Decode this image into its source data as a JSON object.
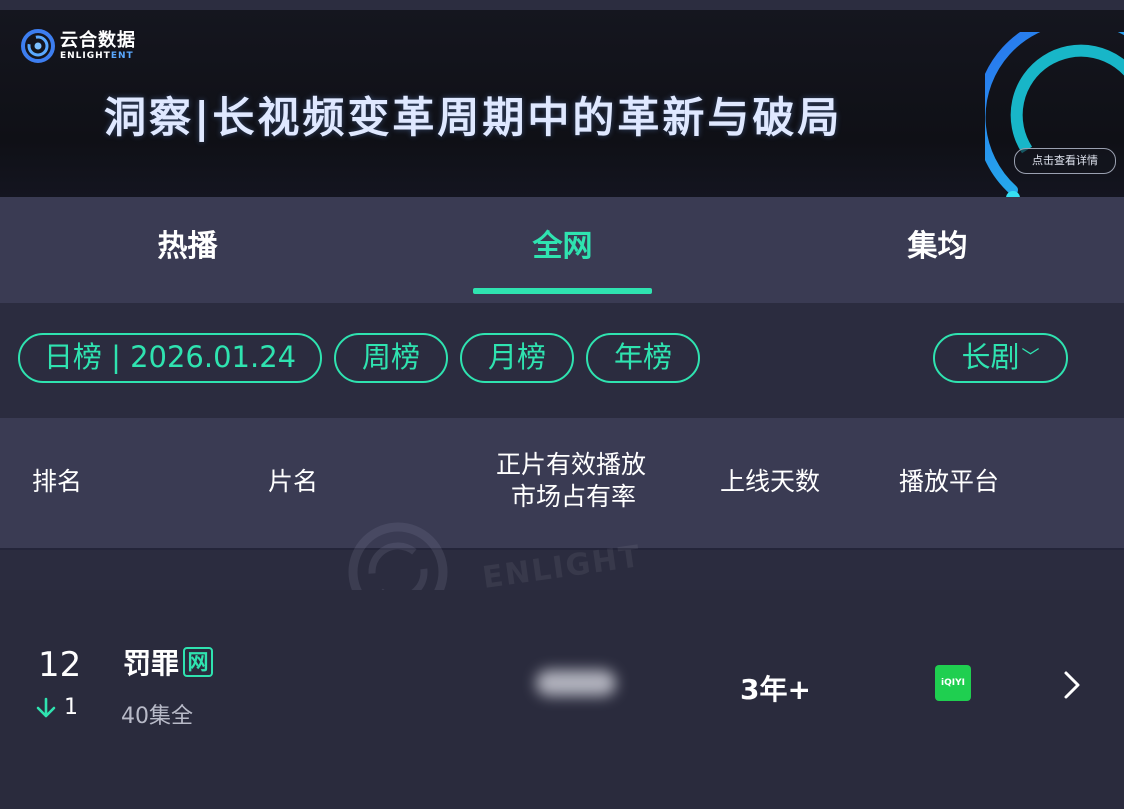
{
  "banner": {
    "logo_cn": "云合数据",
    "logo_en": "ENLIGHT",
    "logo_en_accent": "ENT",
    "title": "洞察|长视频变革周期中的革新与破局",
    "detail_button": "点击查看详情"
  },
  "tabs": [
    {
      "label": "热播",
      "active": false
    },
    {
      "label": "全网",
      "active": true
    },
    {
      "label": "集均",
      "active": false
    }
  ],
  "filters": {
    "daily": "日榜 | 2026.01.24",
    "weekly": "周榜",
    "monthly": "月榜",
    "yearly": "年榜",
    "category": "长剧"
  },
  "table": {
    "headers": {
      "rank": "排名",
      "title": "片名",
      "share_line1": "正片有效播放",
      "share_line2": "市场占有率",
      "days": "上线天数",
      "platform": "播放平台"
    },
    "rows": [
      {
        "rank": "12",
        "rank_change": "1",
        "rank_direction": "down",
        "title": "罚罪",
        "title_badge": "网",
        "episodes": "40集全",
        "days_online": "3年+",
        "platform": "iQIYI"
      }
    ]
  },
  "colors": {
    "accent": "#2fe3b0",
    "tab_bg": "#3a3b53",
    "page_bg": "#2a2b3d",
    "platform_green": "#1fcf50"
  }
}
